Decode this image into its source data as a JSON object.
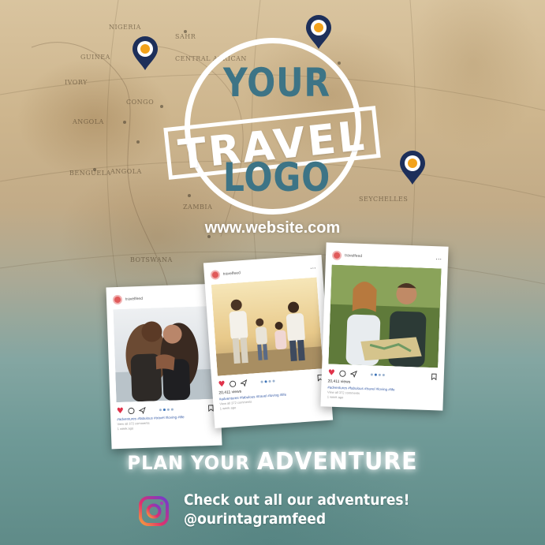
{
  "map_labels": {
    "nigeria": "NIGERIA",
    "sahara": "SAHR",
    "central_african": "CENTRAL AFRICAN",
    "congo": "CONGO",
    "angola": "ANGOLA",
    "zambia": "ZAMBIA",
    "botswana": "BOTSWANA",
    "benguela": "BENGUELA",
    "seychelles": "SEYCHELLES",
    "guinea": "GUINEA",
    "ivory": "IVORY"
  },
  "logo": {
    "top": "YOUR",
    "middle": "TRAVEL",
    "bottom": "LOGO"
  },
  "website": "www.website.com",
  "cards": [
    {
      "user": "travelfeed",
      "likes": "20,411 views",
      "caption": "#adventures #fabulous #travel #loving #life",
      "small": "View all 372 comments",
      "time": "1 week ago"
    },
    {
      "user": "travelfeed",
      "likes": "20,411 views",
      "caption": "#adventures #fabulous #travel #loving #life",
      "small": "View all 372 comments",
      "time": "1 week ago"
    },
    {
      "user": "travelfeed",
      "likes": "20,411 views",
      "caption": "#adventures #fabulous #travel #loving #life",
      "small": "View all 372 comments",
      "time": "1 week ago"
    }
  ],
  "headline": {
    "part1": "PLAN YOUR ",
    "part2": "ADVENTURE"
  },
  "cta": {
    "line1": "Check out all our adventures!",
    "line2": "@ourintagramfeed"
  },
  "colors": {
    "logo_blue": "#3d7486",
    "pin_navy": "#1d2f5a",
    "pin_orange": "#f3a21b",
    "heart_red": "#e0324a"
  },
  "icons": [
    "map-pin-icon",
    "instagram-icon",
    "heart-icon",
    "comment-icon",
    "share-icon",
    "bookmark-icon"
  ]
}
